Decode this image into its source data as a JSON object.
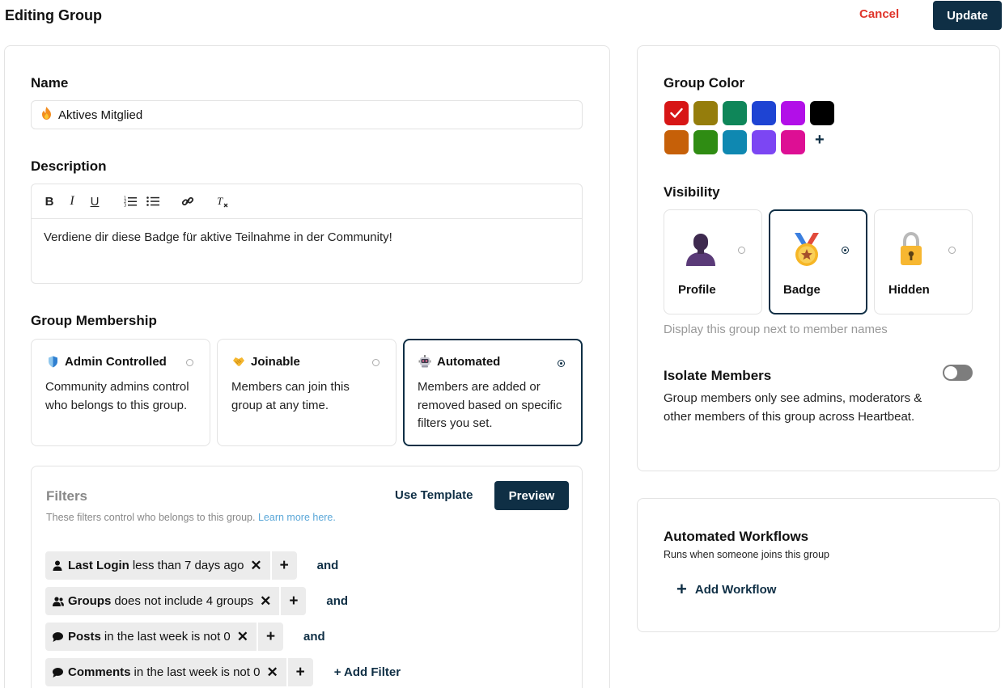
{
  "header": {
    "title": "Editing Group",
    "cancel_label": "Cancel",
    "update_label": "Update"
  },
  "name": {
    "label": "Name",
    "icon": "flame-icon",
    "value": "Aktives Mitglied"
  },
  "description": {
    "label": "Description",
    "toolbar": [
      "bold",
      "italic",
      "underline",
      "ordered-list",
      "bullet-list",
      "link",
      "clear-format"
    ],
    "text": "Verdiene dir diese Badge für aktive Teilnahme in der Community!"
  },
  "membership": {
    "label": "Group Membership",
    "options": [
      {
        "title": "Admin Controlled",
        "icon": "shield-icon",
        "desc": "Community admins control who belongs to this group.",
        "selected": false
      },
      {
        "title": "Joinable",
        "icon": "handshake-icon",
        "desc": "Members can join this group at any time.",
        "selected": false
      },
      {
        "title": "Automated",
        "icon": "robot-icon",
        "desc": "Members are added or removed based on specific filters you set.",
        "selected": true
      }
    ]
  },
  "filters": {
    "title": "Filters",
    "subtitle": "These filters control who belongs to this group.",
    "learn_more": "Learn more here.",
    "use_template": "Use Template",
    "preview": "Preview",
    "rows": [
      {
        "icon": "user-icon",
        "field": "Last Login",
        "condition": "less than 7 days ago",
        "connector": "and"
      },
      {
        "icon": "users-icon",
        "field": "Groups",
        "condition": "does not include 4 groups",
        "connector": "and"
      },
      {
        "icon": "chat-bubble-icon",
        "field": "Posts",
        "condition": "in the last week is not 0",
        "connector": "and"
      },
      {
        "icon": "chat-bubble-icon",
        "field": "Comments",
        "condition": "in the last week is not 0",
        "connector": "+ Add Filter"
      }
    ]
  },
  "group_color": {
    "label": "Group Color",
    "selected": "#d71616",
    "colors": [
      "#d71616",
      "#957d0c",
      "#0f8659",
      "#1e44d3",
      "#b20fe8",
      "#000000",
      "#c66008",
      "#2f8c13",
      "#0f88b1",
      "#7c46f3",
      "#dd0f94"
    ],
    "add_symbol": "+"
  },
  "visibility": {
    "label": "Visibility",
    "options": [
      {
        "label": "Profile",
        "icon": "profile-silhouette-icon",
        "selected": false
      },
      {
        "label": "Badge",
        "icon": "medal-icon",
        "selected": true
      },
      {
        "label": "Hidden",
        "icon": "lock-icon",
        "selected": false
      }
    ],
    "help": "Display this group next to member names"
  },
  "isolate": {
    "title": "Isolate Members",
    "desc": "Group members only see admins, moderators & other members of this group across Heartbeat.",
    "enabled": false
  },
  "workflows": {
    "title": "Automated Workflows",
    "subtitle": "Runs when someone joins this group",
    "add_label": "Add Workflow"
  }
}
